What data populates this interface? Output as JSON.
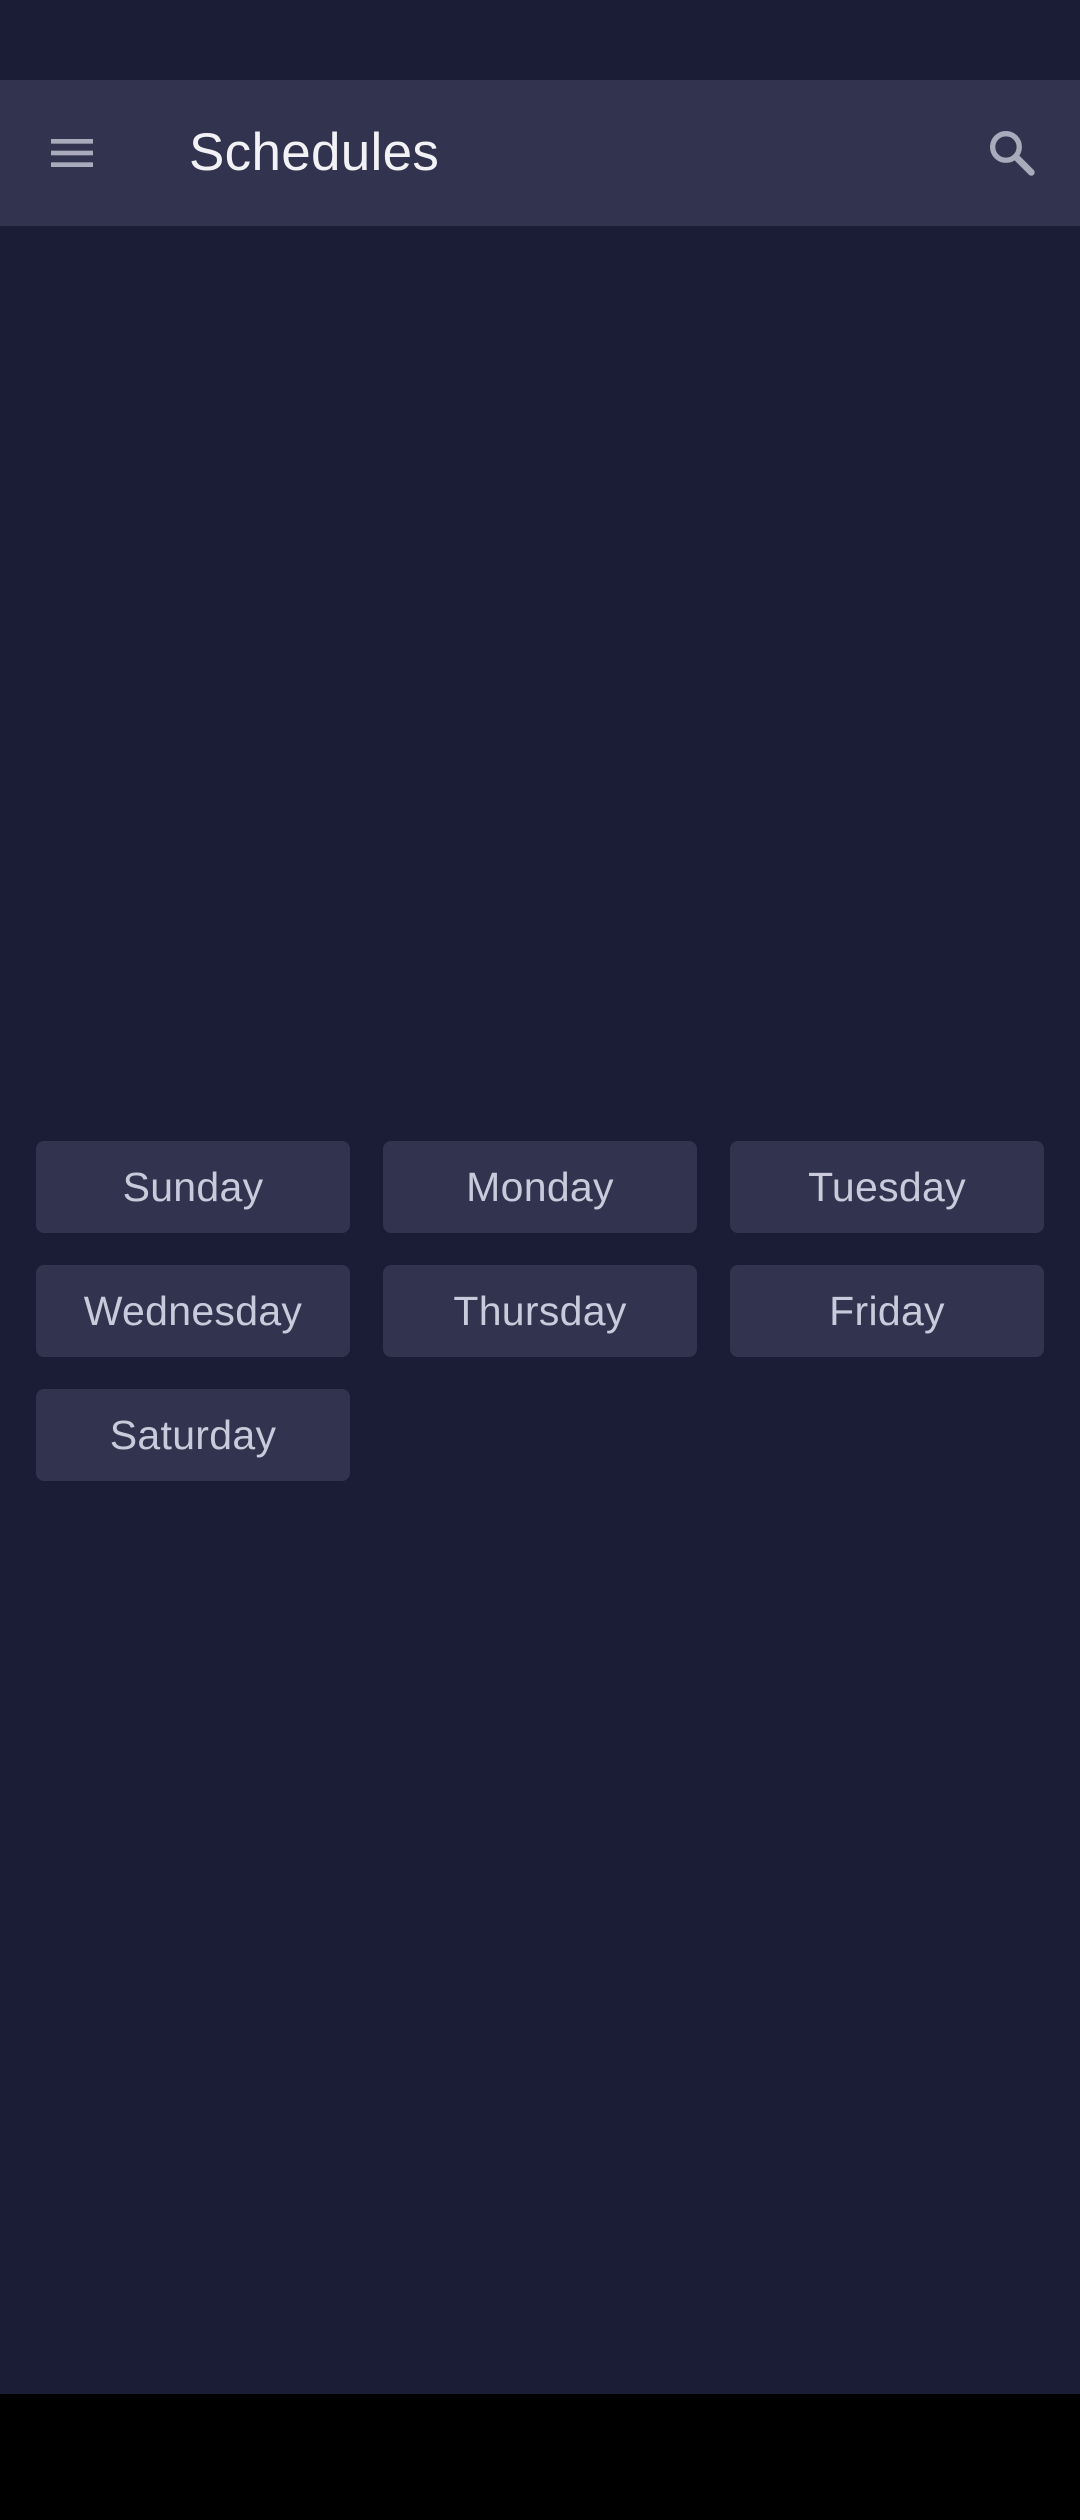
{
  "app_bar": {
    "title": "Schedules",
    "menu_icon": "menu-icon",
    "search_icon": "search-icon"
  },
  "days": [
    {
      "label": "Sunday"
    },
    {
      "label": "Monday"
    },
    {
      "label": "Tuesday"
    },
    {
      "label": "Wednesday"
    },
    {
      "label": "Thursday"
    },
    {
      "label": "Friday"
    },
    {
      "label": "Saturday"
    }
  ],
  "colors": {
    "background": "#1b1c36",
    "surface": "#32334e",
    "title_text": "#f2f2f6",
    "button_text": "#c9cadb",
    "icon": "#a9aabb"
  }
}
